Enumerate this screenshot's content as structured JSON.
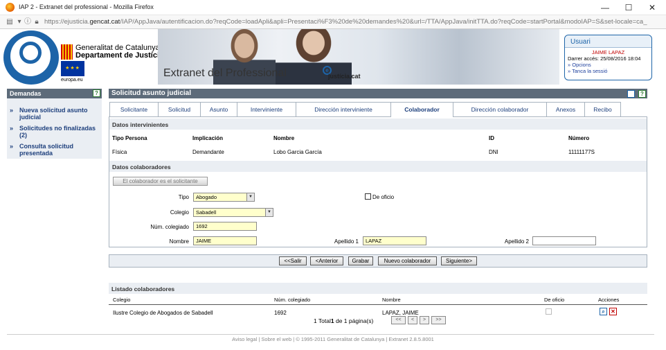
{
  "browser": {
    "window_title": "IAP 2 - Extranet del professional - Mozilla Firefox",
    "url_prefix": "https://ejusticia.",
    "url_domain": "gencat.cat",
    "url_rest": "/IAP/AppJava/autentificacion.do?reqCode=loadApli&apli=Presentaci%F3%20de%20demandes%20&url=/TTA/AppJava/initTTA.do?reqCode=startPortal&modoIAP=S&set-locale=ca_",
    "min_glyph": "—",
    "max_glyph": "☐",
    "close_glyph": "✕"
  },
  "banner": {
    "gencat_line1": "Generalitat de Catalunya",
    "gencat_line2": "Departament de Justícia",
    "eu_label": "europa.eu",
    "title": "Extranet del Professional",
    "justicia_brand": "justícia.cat"
  },
  "user": {
    "heading": "Usuari",
    "name": "JAIME LAPAZ",
    "last_access": "Darrer accés: 25/08/2016 18:04",
    "options": "» Opcions",
    "logout": "» Tanca la sessió"
  },
  "sidebar": {
    "title": "Demandas",
    "items": [
      {
        "arrow": "»",
        "label": "Nueva solicitud asunto judicial"
      },
      {
        "arrow": "»",
        "label": "Solicitudes no finalizadas (2)"
      },
      {
        "arrow": "»",
        "label": "Consulta solicitud presentada"
      }
    ]
  },
  "main": {
    "title": "Solicitud asunto judicial",
    "help_glyph": "?",
    "tabs": [
      {
        "label": "Solicitante"
      },
      {
        "label": "Solicitud"
      },
      {
        "label": "Asunto"
      },
      {
        "label": "Interviniente"
      },
      {
        "label": "Dirección interviniente"
      },
      {
        "label": "Colaborador",
        "active": true
      },
      {
        "label": "Dirección colaborador"
      },
      {
        "label": "Anexos"
      },
      {
        "label": "Recibo"
      }
    ]
  },
  "intervinientes": {
    "section_title": "Datos intervinientes",
    "headers": {
      "tipo_persona": "Tipo Persona",
      "implicacion": "Implicación",
      "nombre": "Nombre",
      "id": "ID",
      "numero": "Número"
    },
    "row": {
      "tipo_persona": "Física",
      "implicacion": "Demandante",
      "nombre": "Lobo Garcia García",
      "id": "DNI",
      "numero": "11111177S"
    }
  },
  "colaboradores": {
    "section_title": "Datos colaboradores",
    "same_as_applicant_button": "El colaborador es el solicitante",
    "tipo_label": "Tipo",
    "tipo_value": "Abogado",
    "de_oficio_label": "De oficio",
    "colegio_label": "Colegio",
    "colegio_value": "Sabadell",
    "num_colegiado_label": "Núm. colegiado",
    "num_colegiado_value": "1692",
    "nombre_label": "Nombre",
    "nombre_value": "JAIME",
    "apellido1_label": "Apellido 1",
    "apellido1_value": "LAPAZ",
    "apellido2_label": "Apellido 2",
    "apellido2_value": ""
  },
  "actions": {
    "first": "<<Salir",
    "previous": "<Anterior",
    "save": "Grabar",
    "new": "Nuevo colaborador",
    "next": "Siguiente>"
  },
  "listado": {
    "title": "Listado colaboradores",
    "headers": {
      "colegio": "Colegio",
      "num_colegiado": "Núm. colegiado",
      "nombre": "Nombre",
      "de_oficio": "De oficio",
      "acciones": "Acciones"
    },
    "rows": [
      {
        "colegio": "Ilustre Colegio de Abogados de Sabadell",
        "num_colegiado": "1692",
        "nombre": "LAPAZ, JAIME"
      }
    ],
    "pager_prefix": "1 Total",
    "pager_current": "1",
    "pager_suffix": " de 1 página(s)",
    "pager_buttons": [
      "<<",
      "<",
      ">",
      ">>"
    ]
  },
  "footer": "Aviso legal  |  Sobre el web  |  © 1995-2011 Generalitat de Catalunya  |  Extranet 2.8.5.8001",
  "colors": {
    "brand_blue": "#1d64a8",
    "header_gray": "#5d6b7a",
    "field_yellow": "#ffffcc",
    "user_red": "#c00000"
  }
}
